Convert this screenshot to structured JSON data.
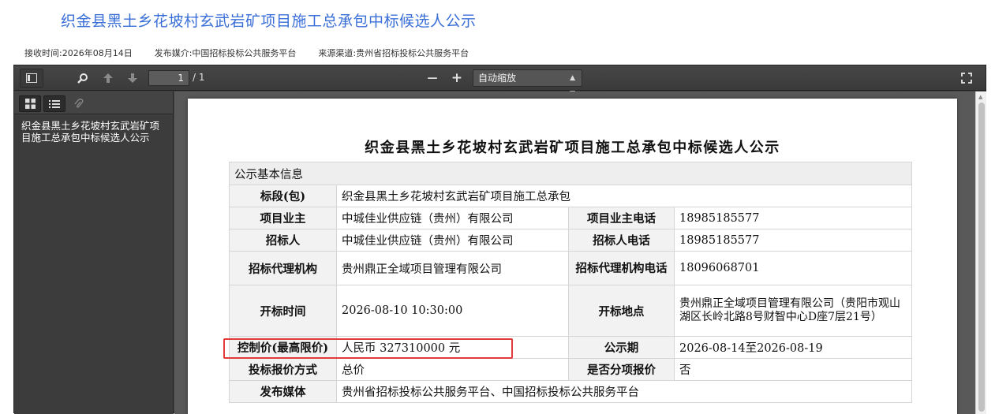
{
  "page": {
    "title": "织金县黑土乡花坡村玄武岩矿项目施工总承包中标候选人公示",
    "meta": {
      "received_time": "接收时间:2026年08月14日",
      "publish_media": "发布媒介:中国招标投标公共服务平台",
      "source_channel": "来源渠道:贵州省招标投标公共服务平台"
    }
  },
  "toolbar": {
    "page_current": "1",
    "page_total": "/ 1",
    "zoom_minus": "—",
    "zoom_plus": "+",
    "zoom_value": "自动缩放"
  },
  "sidebar": {
    "outline_item": "织金县黑土乡花坡村玄武岩矿项目施工总承包中标候选人公示"
  },
  "document": {
    "title": "织金县黑土乡花坡村玄武岩矿项目施工总承包中标候选人公示",
    "section_header": "公示基本信息",
    "rows": {
      "section_label": "标段(包)",
      "section_value": "织金县黑土乡花坡村玄武岩矿项目施工总承包",
      "owner_label": "项目业主",
      "owner_value": "中城佳业供应链（贵州）有限公司",
      "owner_phone_label": "项目业主电话",
      "owner_phone_value": "18985185577",
      "tenderer_label": "招标人",
      "tenderer_value": "中城佳业供应链（贵州）有限公司",
      "tenderer_phone_label": "招标人电话",
      "tenderer_phone_value": "18985185577",
      "agency_label": "招标代理机构",
      "agency_value": "贵州鼎正全域项目管理有限公司",
      "agency_phone_label": "招标代理机构电话",
      "agency_phone_value": "18096068701",
      "open_time_label": "开标时间",
      "open_time_value": "2026-08-10 10:30:00",
      "open_place_label": "开标地点",
      "open_place_value": "贵州鼎正全域项目管理有限公司（贵阳市观山湖区长岭北路8号财智中心D座7层21号）",
      "control_price_label": "控制价(最高限价)",
      "control_price_value": "人民币 327310000 元",
      "period_label": "公示期",
      "period_value": "2026-08-14至2026-08-19",
      "bid_method_label": "投标报价方式",
      "bid_method_value": "总价",
      "split_label": "是否分项报价",
      "split_value": "否",
      "media_label": "发布媒体",
      "media_value": "贵州省招标投标公共服务平台、中国招标投标公共服务平台"
    }
  },
  "colors": {
    "title_blue": "#3a6fd8",
    "highlight_red": "#e23b3b",
    "viewer_dark": "#404040"
  }
}
